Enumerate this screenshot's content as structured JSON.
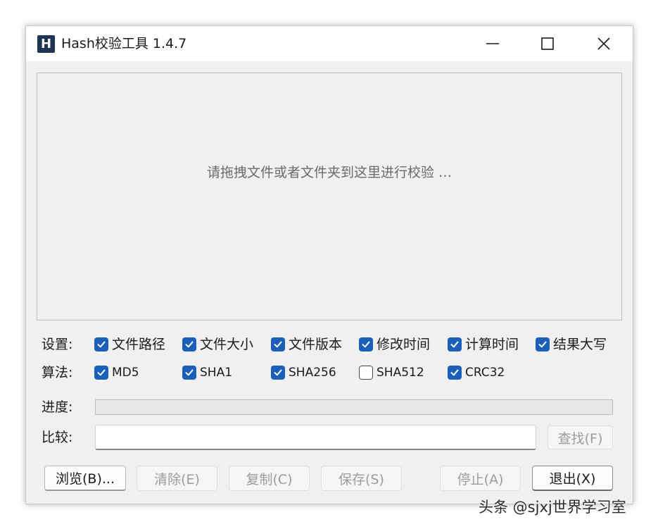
{
  "window": {
    "icon_letter": "H",
    "title": "Hash校验工具 1.4.7"
  },
  "drop_zone": {
    "hint": "请拖拽文件或者文件夹到这里进行校验 …"
  },
  "settings": {
    "label": "设置:",
    "options": [
      {
        "label": "文件路径",
        "checked": true
      },
      {
        "label": "文件大小",
        "checked": true
      },
      {
        "label": "文件版本",
        "checked": true
      },
      {
        "label": "修改时间",
        "checked": true
      },
      {
        "label": "计算时间",
        "checked": true
      },
      {
        "label": "结果大写",
        "checked": true
      }
    ]
  },
  "algorithms": {
    "label": "算法:",
    "options": [
      {
        "label": "MD5",
        "checked": true
      },
      {
        "label": "SHA1",
        "checked": true
      },
      {
        "label": "SHA256",
        "checked": true
      },
      {
        "label": "SHA512",
        "checked": false
      },
      {
        "label": "CRC32",
        "checked": true
      }
    ]
  },
  "progress": {
    "label": "进度:",
    "value": 0
  },
  "compare": {
    "label": "比较:",
    "value": "",
    "find_button": "查找(F)"
  },
  "buttons": {
    "browse": "浏览(B)...",
    "clear": "清除(E)",
    "copy": "复制(C)",
    "save": "保存(S)",
    "stop": "停止(A)",
    "exit": "退出(X)"
  },
  "watermark": "头条 @sjxj世界学习室",
  "colors": {
    "checkbox_accent": "#1b5fb8",
    "app_icon_bg": "#1f3552"
  }
}
